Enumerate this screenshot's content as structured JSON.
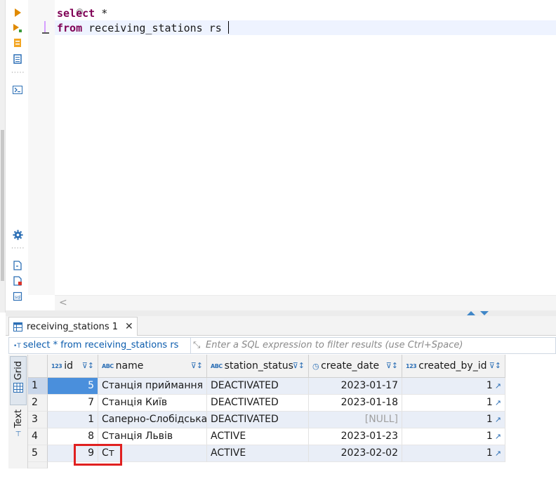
{
  "editor": {
    "line1_kw": "select",
    "line1_rest": " *",
    "line2_kw": "from",
    "line2_rest": " receiving_stations rs ",
    "fold_marker": "⊖"
  },
  "toolbar_icons": [
    "execute-statement-icon",
    "execute-script-icon",
    "explain-plan-icon",
    "load-script-icon",
    "terminal-icon",
    "settings-icon",
    "export-icon",
    "import-icon",
    "format-icon"
  ],
  "results": {
    "tab_label": "receiving_stations 1",
    "tab_close": "✕",
    "filter_query": "select * from receiving_stations rs",
    "filter_placeholder": "Enter a SQL expression to filter results (use Ctrl+Space)",
    "side_tabs": {
      "grid": "Grid",
      "text": "Text"
    },
    "columns": [
      {
        "type": "123",
        "name": "id"
      },
      {
        "type": "ABC",
        "name": "name"
      },
      {
        "type": "ABC",
        "name": "station_status"
      },
      {
        "type": "◷",
        "name": "create_date"
      },
      {
        "type": "123",
        "name": "created_by_id"
      }
    ],
    "rows": [
      {
        "n": "1",
        "id": "5",
        "name": "Станція приймання",
        "status": "DEACTIVATED",
        "date": "2023-01-17",
        "by": "1"
      },
      {
        "n": "2",
        "id": "7",
        "name": "Станція Київ",
        "status": "DEACTIVATED",
        "date": "2023-01-18",
        "by": "1"
      },
      {
        "n": "3",
        "id": "1",
        "name": "Саперно-Слобідська",
        "status": "DEACTIVATED",
        "date": "[NULL]",
        "by": "1"
      },
      {
        "n": "4",
        "id": "8",
        "name": "Станція Львів",
        "status": "ACTIVE",
        "date": "2023-01-23",
        "by": "1"
      },
      {
        "n": "5",
        "id": "9",
        "name": "Ст",
        "status": "ACTIVE",
        "date": "2023-02-02",
        "by": "1"
      }
    ]
  },
  "colors": {
    "keyword": "#7f0055",
    "selection": "#4a8fdc",
    "alt_row": "#e9eef7",
    "annotation": "#e02020"
  }
}
